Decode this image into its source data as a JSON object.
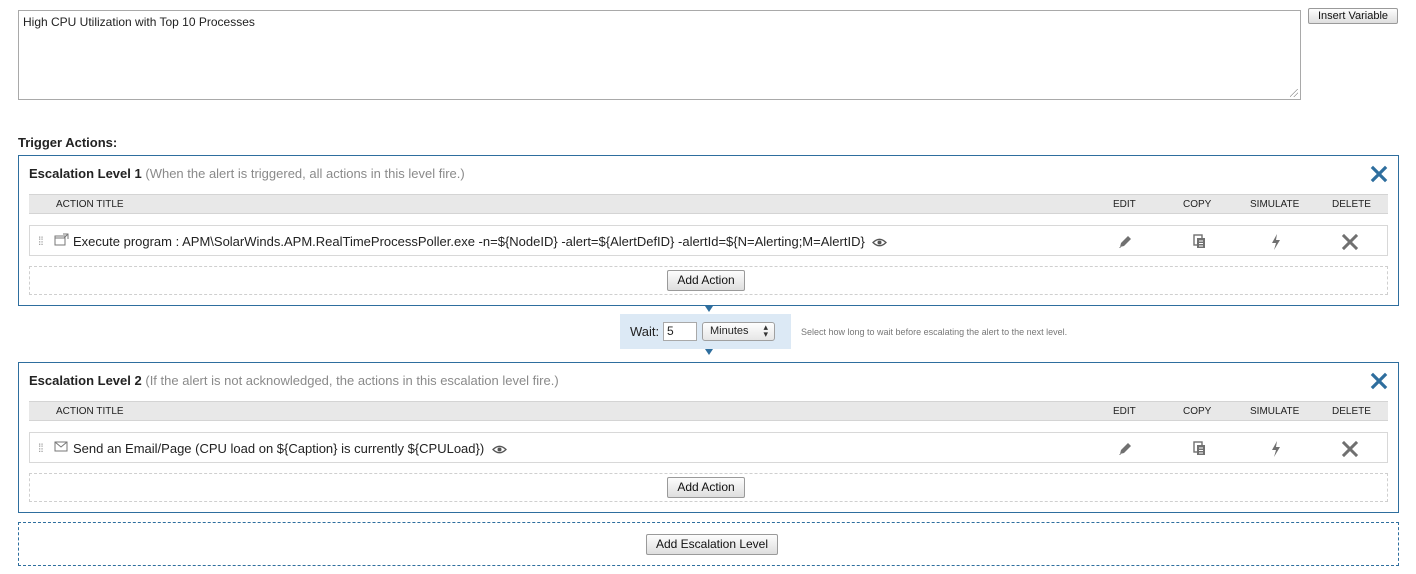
{
  "message": {
    "text": "High CPU Utilization with Top 10 Processes",
    "insert_variable_label": "Insert Variable"
  },
  "trigger_actions_label": "Trigger Actions:",
  "table_headers": {
    "action_title": "ACTION TITLE",
    "edit": "EDIT",
    "copy": "COPY",
    "simulate": "SIMULATE",
    "delete": "DELETE"
  },
  "levels": [
    {
      "title": "Escalation Level 1",
      "subtitle": "(When the alert is triggered, all actions in this level fire.)",
      "actions": [
        {
          "type_icon": "execute-program-icon",
          "title": "Execute program : APM\\SolarWinds.APM.RealTimeProcessPoller.exe -n=${NodeID} -alert=${AlertDefID} -alertId=${N=Alerting;M=AlertID}"
        }
      ],
      "add_action_label": "Add Action"
    },
    {
      "title": "Escalation Level 2",
      "subtitle": "(If the alert is not acknowledged, the actions in this escalation level fire.)",
      "actions": [
        {
          "type_icon": "email-icon",
          "title": "Send an Email/Page (CPU load on ${Caption} is currently ${CPULoad})"
        }
      ],
      "add_action_label": "Add Action"
    }
  ],
  "wait": {
    "label": "Wait:",
    "value": "5",
    "unit": "Minutes",
    "hint": "Select how long to wait before escalating the alert to the next level."
  },
  "add_escalation_level_label": "Add Escalation Level",
  "colors": {
    "accent": "#2e6e9e",
    "wait_bg": "#dce9f5",
    "header_bg": "#e8e8e8",
    "icon_gray": "#707070"
  }
}
